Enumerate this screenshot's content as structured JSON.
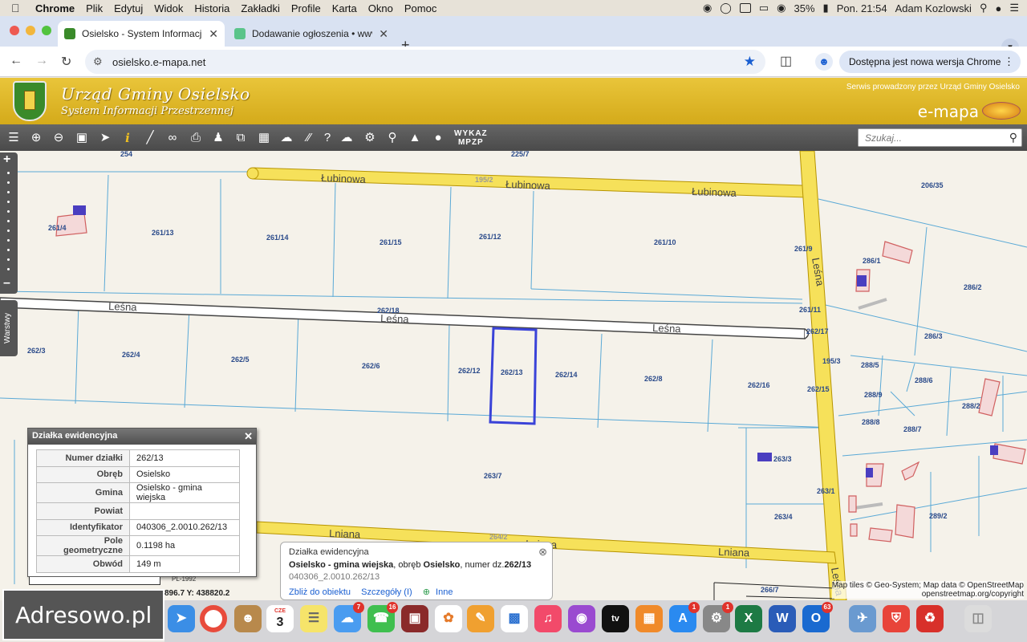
{
  "menubar": {
    "app": "Chrome",
    "items": [
      "Plik",
      "Edytuj",
      "Widok",
      "Historia",
      "Zakładki",
      "Profile",
      "Karta",
      "Okno",
      "Pomoc"
    ],
    "battery": "35%",
    "clock": "Pon. 21:54",
    "user": "Adam Kozlowski"
  },
  "tabs": [
    {
      "title": "Osielsko - System Informacji",
      "active": true
    },
    {
      "title": "Dodawanie ogłoszenia • www",
      "active": false
    }
  ],
  "address_bar": {
    "url": "osielsko.e-mapa.net"
  },
  "update_notice": "Dostępna jest nowa wersja Chrome",
  "site_header": {
    "title": "Urząd Gminy Osielsko",
    "subtitle": "System Informacji Przestrzennej",
    "operator": "Serwis prowadzony przez Urząd Gminy Osielsko",
    "logo": "e-mapa"
  },
  "map_toolbar": {
    "wykaz_line1": "WYKAZ",
    "wykaz_line2": "MPZP",
    "search_placeholder": "Szukaj..."
  },
  "layers_tab": "Warstwy",
  "streets": [
    "Łubinowa",
    "Łubinowa",
    "Łubinowa",
    "Leśna",
    "Leśna",
    "Leśna",
    "Leśna",
    "Lniana",
    "Lniana",
    "Lniana",
    "Leśna"
  ],
  "parcels": [
    "254",
    "225/7",
    "195/2",
    "206/35",
    "261/4",
    "261/13",
    "261/14",
    "261/15",
    "261/12",
    "261/10",
    "261/9",
    "286/1",
    "286/2",
    "262/18",
    "261/11",
    "286/3",
    "262/17",
    "262/3",
    "262/4",
    "262/5",
    "262/6",
    "262/12",
    "262/13",
    "262/14",
    "262/8",
    "262/16",
    "195/3",
    "288/5",
    "288/6",
    "288/9",
    "262/15",
    "288/2",
    "288/8",
    "288/7",
    "263/3",
    "263/7",
    "263/1",
    "263/4",
    "289/2",
    "264/2",
    "266/7"
  ],
  "attribute_panel": {
    "title": "Działka ewidencyjna",
    "rows": [
      {
        "key": "Numer działki",
        "value": "262/13"
      },
      {
        "key": "Obręb",
        "value": "Osielsko"
      },
      {
        "key": "Gmina",
        "value": "Osielsko - gmina wiejska"
      },
      {
        "key": "Powiat",
        "value": ""
      },
      {
        "key": "Identyfikator",
        "value": "040306_2.0010.262/13"
      },
      {
        "key": "Pole geometryczne",
        "value": "0.1198 ha"
      },
      {
        "key": "Obwód",
        "value": "149 m"
      }
    ]
  },
  "info_popup": {
    "heading": "Działka ewidencyjna",
    "gmina": "Osielsko - gmina wiejska",
    "sep1": ", obręb ",
    "obreb": "Osielsko",
    "sep2": ", numer dz.",
    "numer": "262/13",
    "identifier": "040306_2.0010.262/13",
    "links": [
      "Zbliż do obiektu",
      "Szczegóły (I)",
      "Inne"
    ]
  },
  "crs": "PL-1992",
  "coords": "896.7   Y: 438820.2",
  "attribution_1": "Map tiles © Geo-System; Map data © OpenStreetMap",
  "attribution_2": "openstreetmap.org/copyright",
  "watermark": "Adresowo.pl",
  "dock_badges": {
    "messages": "7",
    "facetime": "16",
    "appstore": "1",
    "settings": "1",
    "outlook": "63",
    "calendar_month": "CZE",
    "calendar_day": "3"
  },
  "colors": {
    "road_fill": "#f6e15a",
    "road_edge": "#c8a400",
    "parcel_line": "#5aa9d6",
    "selected_parcel": "#3a43d8",
    "building": "#d66",
    "header_bg": "#dcb322"
  }
}
